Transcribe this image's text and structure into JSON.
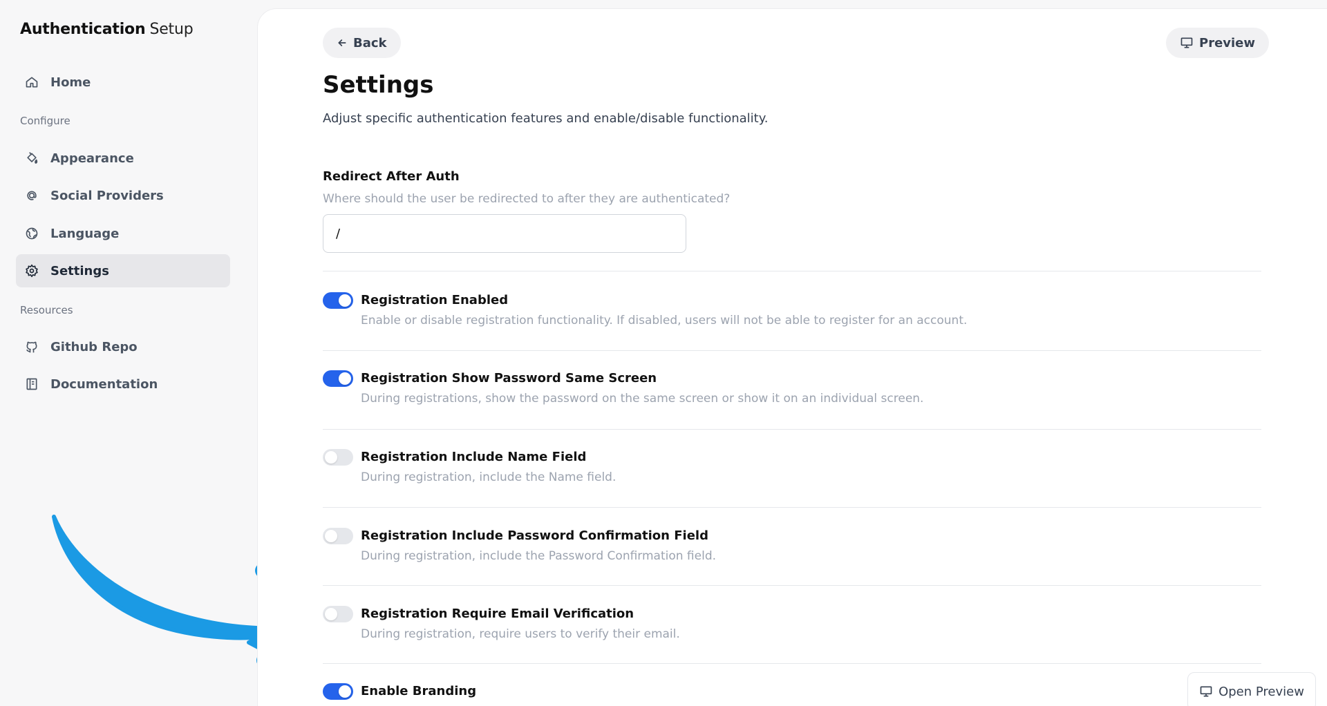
{
  "app": {
    "title_strong": "Authentication",
    "title_light": "Setup"
  },
  "sidebar": {
    "items": [
      {
        "label": "Home",
        "icon": "home-icon"
      },
      {
        "label": "Appearance",
        "icon": "paint-bucket-icon"
      },
      {
        "label": "Social Providers",
        "icon": "at-sign-icon"
      },
      {
        "label": "Language",
        "icon": "globe-icon"
      },
      {
        "label": "Settings",
        "icon": "gear-icon",
        "active": true
      },
      {
        "label": "Github Repo",
        "icon": "github-icon"
      },
      {
        "label": "Documentation",
        "icon": "book-icon"
      }
    ],
    "sections": {
      "configure": "Configure",
      "resources": "Resources"
    }
  },
  "header": {
    "back_label": "Back",
    "preview_label": "Preview"
  },
  "page": {
    "title": "Settings",
    "subtitle": "Adjust specific authentication features and enable/disable functionality."
  },
  "redirect": {
    "label": "Redirect After Auth",
    "help": "Where should the user be redirected to after they are authenticated?",
    "value": "/"
  },
  "settings": [
    {
      "label": "Registration Enabled",
      "desc": "Enable or disable registration functionality. If disabled, users will not be able to register for an account.",
      "enabled": true
    },
    {
      "label": "Registration Show Password Same Screen",
      "desc": "During registrations, show the password on the same screen or show it on an individual screen.",
      "enabled": true
    },
    {
      "label": "Registration Include Name Field",
      "desc": "During registration, include the Name field.",
      "enabled": false
    },
    {
      "label": "Registration Include Password Confirmation Field",
      "desc": "During registration, include the Password Confirmation field.",
      "enabled": false
    },
    {
      "label": "Registration Require Email Verification",
      "desc": "During registration, require users to verify their email.",
      "enabled": false
    },
    {
      "label": "Enable Branding",
      "desc": "",
      "enabled": true
    }
  ],
  "floating": {
    "open_preview_label": "Open Preview"
  },
  "colors": {
    "accent": "#2563eb",
    "annotation_arrow": "#1b9ae4"
  }
}
